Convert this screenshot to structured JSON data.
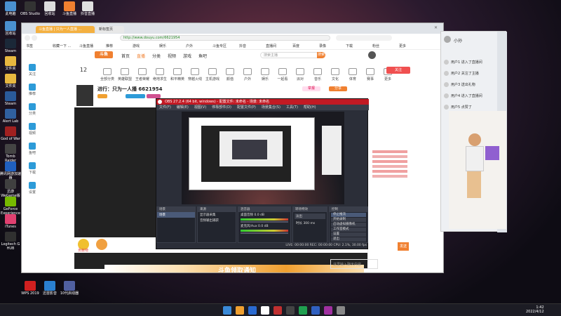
{
  "desktop": {
    "icons": [
      {
        "label": "此电脑",
        "color": "#4a90d0"
      },
      {
        "label": "OBS Studio",
        "color": "#333333"
      },
      {
        "label": "回收站",
        "color": "#dddddd"
      },
      {
        "label": "斗鱼直播",
        "color": "#f08030"
      },
      {
        "label": "抖音直播",
        "color": "#e0e0e0"
      },
      {
        "label": "回收站",
        "color": "#4a90d0"
      },
      {
        "label": "Steam",
        "color": "#1b2838"
      },
      {
        "label": "文件夹",
        "color": "#e8b840"
      },
      {
        "label": "文件夹",
        "color": "#e8b840"
      },
      {
        "label": "Steam",
        "color": "#2a5a9a"
      },
      {
        "label": "Alert Lab",
        "color": "#3060a0"
      },
      {
        "label": "God of War",
        "color": "#a02020"
      },
      {
        "label": "Tomb Raider",
        "color": "#444444"
      },
      {
        "label": "腾讯网游加速器",
        "color": "#2060c0"
      },
      {
        "label": "迅游WeGame版",
        "color": "#404040"
      },
      {
        "label": "GeForce Experience",
        "color": "#76b900"
      },
      {
        "label": "iTunes",
        "color": "#e04070"
      },
      {
        "label": "Logitech G HUB",
        "color": "#303030"
      }
    ],
    "bottom_icons": [
      {
        "label": "WPS 2019",
        "color": "#d02020"
      },
      {
        "label": "迅雷影音",
        "color": "#2a80d0"
      },
      {
        "label": "10代启动器",
        "color": "#5060a0"
      }
    ]
  },
  "browser": {
    "tabs": [
      "斗鱼直播 | 只为一人直播 ...",
      "新标签页"
    ],
    "address": "http://www.douyu.com/6621954",
    "bookmarks": [
      "书签",
      "收藏一下 ...",
      "斗鱼直播",
      "推荐",
      "游戏",
      "娱乐",
      "户外",
      "斗鱼专区",
      "抖音",
      "直播间",
      "百度",
      "录像",
      "下载",
      "粉丝",
      "更多"
    ],
    "nav": {
      "logo": "斗鱼",
      "items": [
        "首页",
        "直播",
        "分类",
        "视频",
        "游戏",
        "鱼吧"
      ],
      "search_placeholder": "搜索主播",
      "search_button": "搜索"
    },
    "categories": [
      "全部分类",
      "英雄联盟",
      "王者荣耀",
      "绝地求生",
      "和平精英",
      "穿越火线",
      "主机游戏",
      "颜值",
      "户外",
      "娱乐",
      "一起看",
      "派对",
      "音乐",
      "文化",
      "体育",
      "赛事",
      "更多"
    ],
    "room": {
      "title": "进行：只为一人播 6621954",
      "level_badge": "12",
      "follow_button": "关注",
      "report": "举报",
      "share": "分享",
      "send_button": "发送",
      "chat_placeholder": "这里输入聊天内容",
      "bottom_banner": "斗鱼领取通知",
      "rank_label": "贡献榜",
      "gift_label": "礼物"
    },
    "side_nav": [
      "关注",
      "推荐",
      "分类",
      "视频",
      "鱼吧",
      "下载",
      "设置"
    ]
  },
  "obs": {
    "title": "OBS 27.2.4 (64 bit, windows) - 配置文件: 未命名 - 场景: 未命名",
    "menu": [
      "文件(F)",
      "编辑(E)",
      "视图(V)",
      "停靠部件(D)",
      "配置文件(P)",
      "场景集合(S)",
      "工具(T)",
      "帮助(H)"
    ],
    "docks": {
      "scenes": {
        "title": "场景",
        "items": [
          "场景"
        ]
      },
      "sources": {
        "title": "来源",
        "items": [
          "显示器采集",
          "音频输出捕获"
        ]
      },
      "mixer": {
        "title": "混音器",
        "items": [
          "桌面音频",
          "麦克风/Aux"
        ],
        "levels": [
          "0.0 dB",
          "0.0 dB"
        ]
      },
      "transitions": {
        "title": "转场特效",
        "fade": "淡出",
        "duration_label": "时长",
        "duration": "300 ms"
      },
      "controls": {
        "title": "控制",
        "buttons": [
          "停止推流",
          "开始录制",
          "启动虚拟摄像机",
          "工作室模式",
          "设置",
          "退出"
        ]
      }
    },
    "status": [
      "LIVE: 00:00:00",
      "REC: 00:00:00",
      "CPU: 2.1%, 30.00 fps"
    ]
  },
  "chat_panel": {
    "user": "小孙",
    "messages": [
      "用户1 进入了直播间",
      "用户2 关注了主播",
      "用户3 送出礼物",
      "用户4 进入了直播间",
      "用户5 点赞了"
    ]
  },
  "taskbar": {
    "time": "1:42",
    "date": "2022/4/12",
    "app_colors": [
      "#f0a030",
      "#2a6ad0",
      "#ffffff",
      "#c03030",
      "#444444",
      "#20a050",
      "#3060c0",
      "#a030a0",
      "#888888"
    ]
  }
}
